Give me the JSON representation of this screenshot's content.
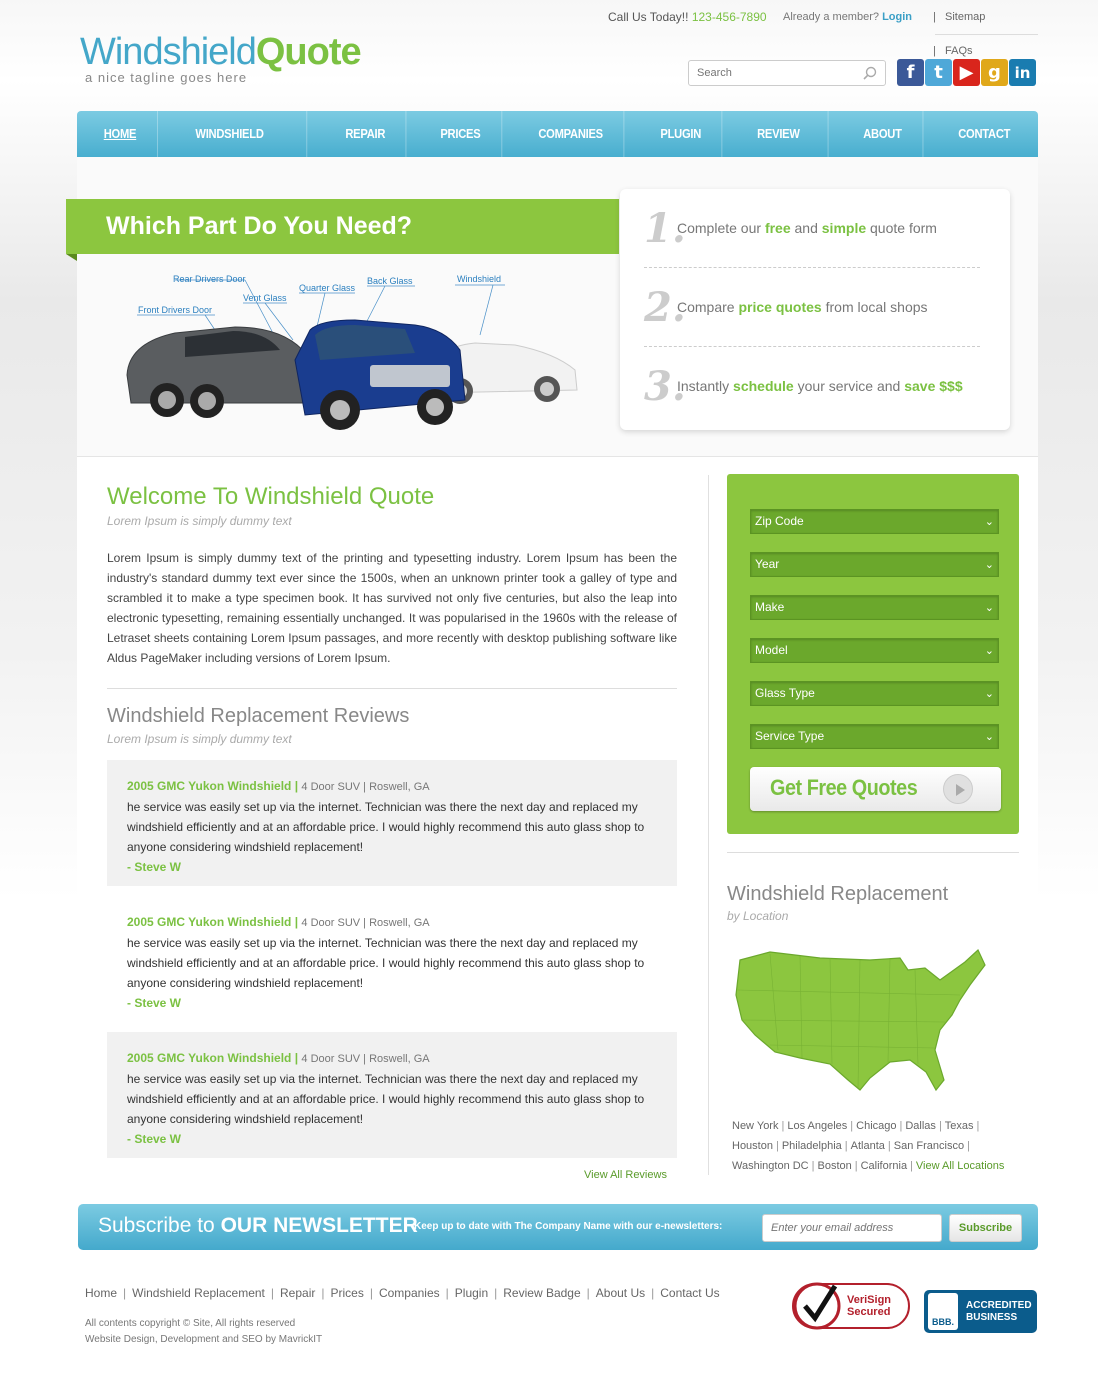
{
  "header": {
    "logo_part1": "Windshield",
    "logo_part2": "Quote",
    "tagline": "a nice tagline goes here",
    "call_label": "Call Us Today!!",
    "phone": "123-456-7890",
    "member_label": "Already a member?",
    "login": "Login",
    "sitemap": "Sitemap",
    "faqs": "FAQs",
    "search_placeholder": "Search",
    "social": [
      {
        "icon": "facebook-icon",
        "glyph": "f",
        "color": "#3b5998"
      },
      {
        "icon": "twitter-icon",
        "glyph": "t",
        "color": "#4fa8d8"
      },
      {
        "icon": "youtube-icon",
        "glyph": "▶",
        "color": "#d9251c"
      },
      {
        "icon": "google-icon",
        "glyph": "g",
        "color": "#e0a81a"
      },
      {
        "icon": "linkedin-icon",
        "glyph": "in",
        "color": "#1a7cb0"
      }
    ]
  },
  "nav": [
    "HOME",
    "WINDSHIELD REPLACEMENT",
    "REPAIR",
    "PRICES",
    "COMPANIES",
    "PLUGIN",
    "REVIEW BADGE",
    "ABOUT US",
    "CONTACT US"
  ],
  "hero": {
    "title": "Which Part Do You Need?",
    "car_labels": [
      "Rear Drivers Door",
      "Vent Glass",
      "Quarter Glass",
      "Back Glass",
      "Windshield",
      "Front Drivers Door"
    ],
    "steps": [
      {
        "num": "1.",
        "parts": [
          "Complete our ",
          "free",
          " and ",
          "simple",
          " quote form"
        ]
      },
      {
        "num": "2.",
        "parts": [
          "Compare ",
          "price quotes",
          " from local shops",
          "",
          ""
        ]
      },
      {
        "num": "3.",
        "parts": [
          "Instantly ",
          "schedule",
          " your service and ",
          "save $$$",
          ""
        ]
      }
    ]
  },
  "welcome": {
    "title": "Welcome To Windshield Quote",
    "subtitle": "Lorem Ipsum is simply dummy text",
    "body": "Lorem Ipsum is simply dummy text of the printing and typesetting industry. Lorem Ipsum has been the industry's standard dummy text ever since the 1500s, when an unknown printer took a galley of type and scrambled it to make a type specimen book. It has survived not only five centuries, but also the leap into electronic typesetting, remaining essentially unchanged. It was popularised in the 1960s with the release of Letraset sheets containing Lorem Ipsum passages, and more recently with desktop publishing software like Aldus PageMaker including versions of Lorem Ipsum."
  },
  "reviews": {
    "title": "Windshield Replacement Reviews",
    "subtitle": "Lorem Ipsum is simply dummy text",
    "items": [
      {
        "title": "2005 GMC Yukon Windshield |",
        "meta": "4 Door SUV | Roswell, GA",
        "text": "he service was easily set up via the internet. Technician was there the next day and replaced my windshield efficiently and at an affordable price. I would highly recommend this auto glass shop to anyone considering windshield replacement!",
        "author": "- Steve W"
      },
      {
        "title": "2005 GMC Yukon Windshield |",
        "meta": "4 Door SUV | Roswell, GA",
        "text": "he service was easily set up via the internet. Technician was there the next day and replaced my windshield efficiently and at an affordable price. I would highly recommend this auto glass shop to anyone considering windshield replacement!",
        "author": "- Steve W"
      },
      {
        "title": "2005 GMC Yukon Windshield |",
        "meta": "4 Door SUV | Roswell, GA",
        "text": "he service was easily set up via the internet. Technician was there the next day and replaced my windshield efficiently and at an affordable price. I would highly recommend this auto glass shop to anyone considering windshield replacement!",
        "author": "- Steve W"
      }
    ],
    "view_all": "View All Reviews"
  },
  "quote_form": {
    "selects": [
      "Zip Code",
      "Year",
      "Make",
      "Model",
      "Glass Type",
      "Service Type"
    ],
    "button": "Get Free Quotes"
  },
  "location": {
    "title": "Windshield Replacement",
    "subtitle": "by Location",
    "cities": [
      "New York",
      "Los Angeles",
      "Chicago",
      "Dallas",
      "Texas",
      "Houston",
      "Philadelphia",
      "Atlanta",
      "San Francisco",
      "Washington DC",
      "Boston",
      "California"
    ],
    "view_all": "View All Locations"
  },
  "newsletter": {
    "title_light": "Subscribe to ",
    "title_bold": "OUR NEWSLETTER",
    "text": "Keep up to date with The Company Name with our e-newsletters:",
    "placeholder": "Enter your email address",
    "button": "Subscribe"
  },
  "footer": {
    "links": [
      "Home",
      "Windshield Replacement",
      "Repair",
      "Prices",
      "Companies",
      "Plugin",
      "Review Badge",
      "About Us",
      "Contact Us"
    ],
    "copyright": "All contents copyright © Site, All rights reserved",
    "credit": "Website Design, Development and SEO by MavrickIT",
    "verisign_line1": "VeriSign",
    "verisign_line2": "Secured",
    "bbb_logo": "BBB.",
    "bbb_line1": "ACCREDITED",
    "bbb_line2": "BUSINESS"
  },
  "colors": {
    "green": "#8cc63f",
    "blue": "#48aecf",
    "logo_blue": "#44a7c9"
  }
}
